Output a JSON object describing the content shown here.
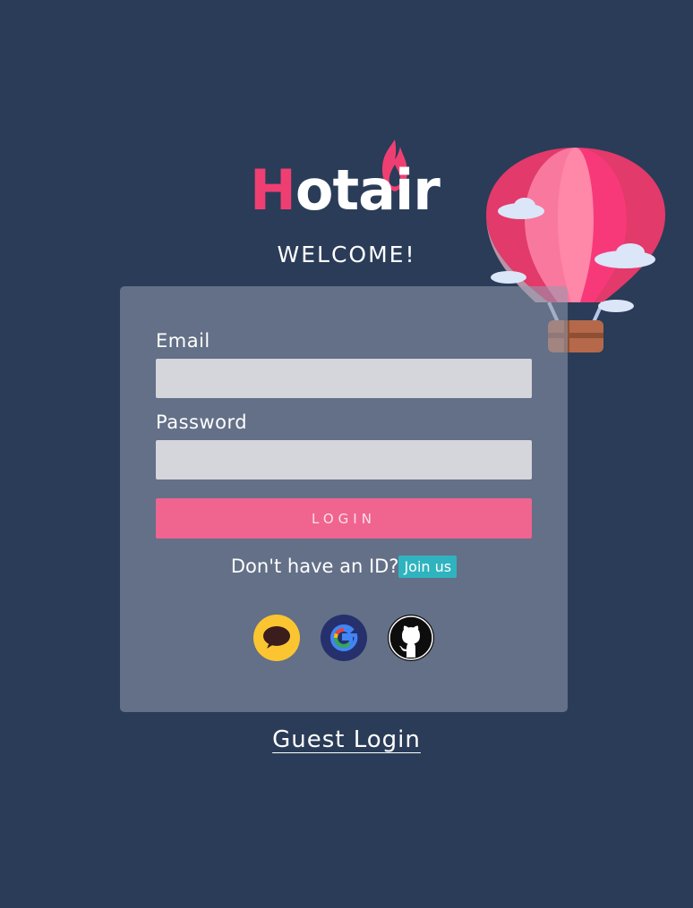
{
  "brand": {
    "logo_first": "H",
    "logo_rest": "otair",
    "colors": {
      "accent": "#ef3f72",
      "background": "#2a3c58",
      "button": "#f06490",
      "join": "#2fb3bf"
    }
  },
  "welcome": "WELCOME!",
  "form": {
    "email_label": "Email",
    "email_value": "",
    "password_label": "Password",
    "password_value": "",
    "login_label": "LOGIN"
  },
  "signup": {
    "prompt": "Don't have an ID?",
    "join_label": "Join us"
  },
  "social": [
    {
      "icon": "kakao-talk-icon"
    },
    {
      "icon": "google-icon"
    },
    {
      "icon": "github-icon"
    }
  ],
  "guest_login": "Guest Login"
}
